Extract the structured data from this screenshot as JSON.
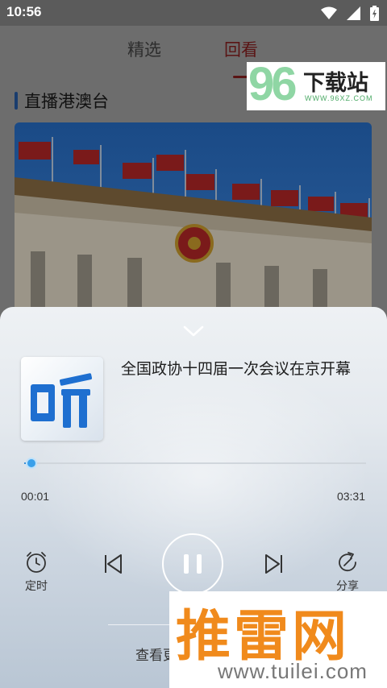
{
  "status_bar": {
    "time": "10:56"
  },
  "tabs": [
    {
      "label": "精选"
    },
    {
      "label": "回看"
    }
  ],
  "section": {
    "title": "直播港澳台"
  },
  "watermark_top": {
    "number": "96",
    "name": "下载站",
    "url": "WWW.96XZ.COM"
  },
  "player": {
    "cover_text": "听",
    "title": "全国政协十四届一次会议在京开幕",
    "progress": 0.005,
    "current_time": "00:01",
    "total_time": "03:31",
    "timer_label": "定时",
    "share_label": "分享",
    "more_label": "查看更"
  },
  "watermark_bottom": {
    "name": "推雷网",
    "url": "www.tuilei.com"
  },
  "colors": {
    "accent_blue": "#3aa0ea",
    "tab_selected": "#5a1414",
    "watermark_orange": "#f08a1c"
  },
  "icons": [
    "wifi-icon",
    "signal-icon",
    "battery-icon",
    "chevron-down-icon",
    "alarm-clock-icon",
    "skip-previous-icon",
    "pause-icon",
    "skip-next-icon",
    "share-icon"
  ]
}
